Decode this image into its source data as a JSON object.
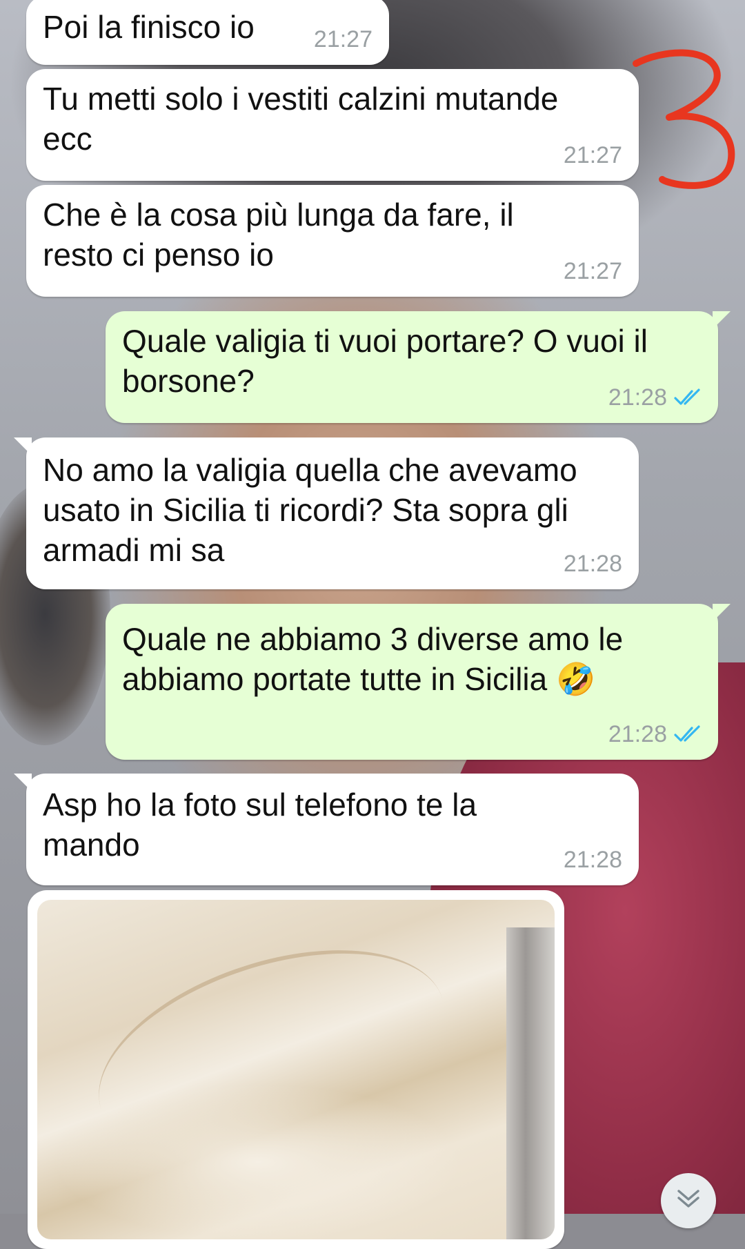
{
  "messages": [
    {
      "id": "m1",
      "side": "incoming",
      "text": "Poi la finisco io",
      "time": "21:27"
    },
    {
      "id": "m2",
      "side": "incoming",
      "text": "Tu metti solo i vestiti calzini mutande\necc",
      "time": "21:27"
    },
    {
      "id": "m3",
      "side": "incoming",
      "text": "Che è la cosa più lunga da fare, il\nresto ci penso io",
      "time": "21:27"
    },
    {
      "id": "m4",
      "side": "outgoing",
      "text": "Quale valigia ti vuoi portare? O vuoi il\nborsone?",
      "time": "21:28",
      "status": "read"
    },
    {
      "id": "m5",
      "side": "incoming",
      "text": "No amo la valigia quella che avevamo\nusato in Sicilia ti ricordi? Sta sopra gli\narmadi mi sa",
      "time": "21:28"
    },
    {
      "id": "m6",
      "side": "outgoing",
      "text": "Quale ne abbiamo 3 diverse amo le\nabbiamo portate tutte in Sicilia 🤣",
      "time": "21:28",
      "status": "read"
    },
    {
      "id": "m7",
      "side": "incoming",
      "text": "Asp ho la foto sul telefono te la\nmando",
      "time": "21:28"
    }
  ],
  "annotation_mark": "3",
  "colors": {
    "incoming_bubble": "#ffffff",
    "outgoing_bubble": "#e6ffd5",
    "read_ticks": "#34b7f1",
    "annotation": "#e8361f"
  },
  "icons": {
    "read_receipt": "double-check-icon",
    "scroll_down": "chevron-double-down-icon"
  }
}
